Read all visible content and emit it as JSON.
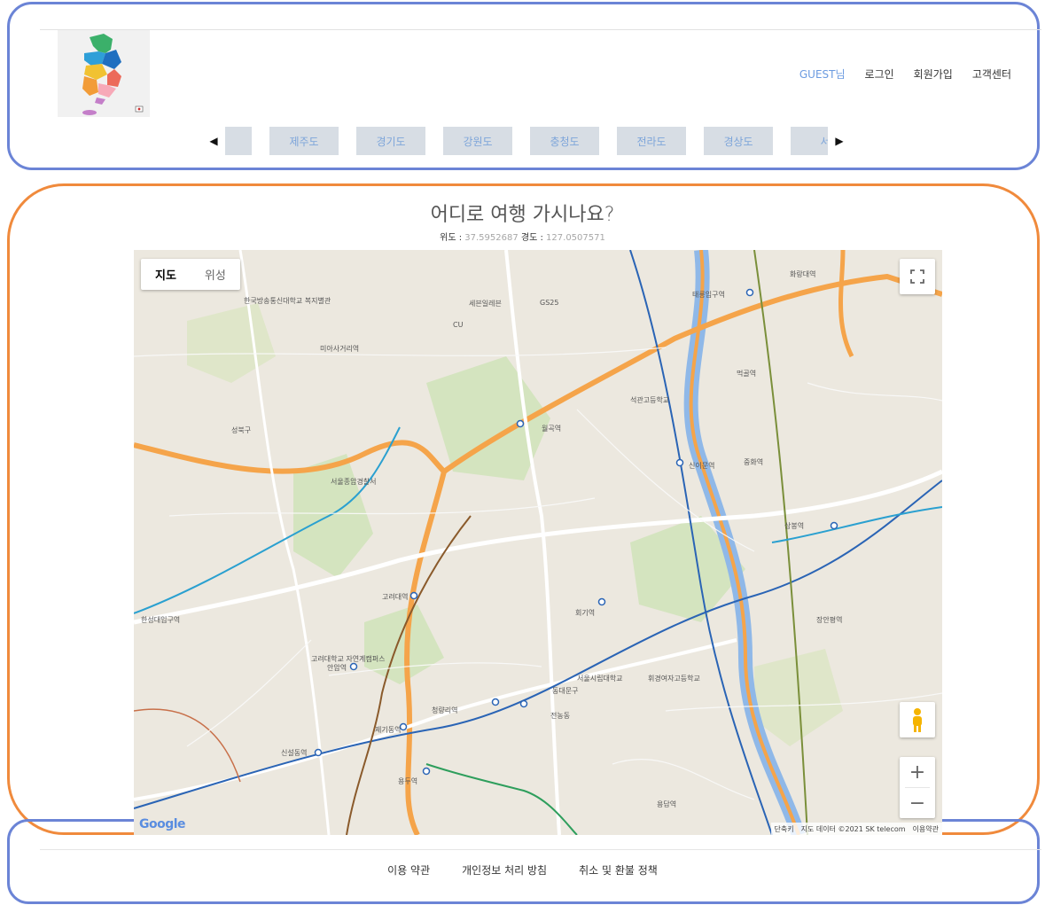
{
  "header": {
    "user": {
      "guest_label": "GUEST님",
      "login": "로그인",
      "signup": "회원가입",
      "support": "고객센터"
    },
    "regions": {
      "prev_arrow": "◀",
      "next_arrow": "▶",
      "items": [
        "제주도",
        "경기도",
        "강원도",
        "충청도",
        "전라도",
        "경상도",
        "서"
      ]
    }
  },
  "main": {
    "title": "어디로 여행 가시나요?",
    "latitude_label": "위도 :",
    "latitude_value": "37.5952687",
    "longitude_label": "경도 :",
    "longitude_value": "127.0507571",
    "map": {
      "type_map": "지도",
      "type_satellite": "위성",
      "zoom_in": "+",
      "zoom_out": "−",
      "google": "Google",
      "attribution": [
        "단축키",
        "지도 데이터 ©2021 SK telecom",
        "이용약관"
      ],
      "labels": [
        "한국방송통신대학교 복지별관",
        "세븐일레븐",
        "GS25",
        "CU",
        "태릉입구역",
        "화랑대역",
        "미아사거리역",
        "성북구",
        "월곡역",
        "석관고등학교",
        "신이문역",
        "서울종암경찰서",
        "고려대역",
        "회기역",
        "한성대입구역",
        "안암역",
        "청량리역",
        "제기동역",
        "신설동역",
        "용두역",
        "상봉역",
        "중화역",
        "먹골역",
        "장안평역",
        "고려대학교 자연계캠퍼스",
        "서울시립대학교",
        "휘경여자고등학교",
        "동대문구",
        "전농동",
        "용답역"
      ]
    }
  },
  "footer": {
    "links": [
      "이용 약관",
      "개인정보 처리 방침",
      "취소 및 환불 정책"
    ]
  },
  "colors": {
    "header_frame": "#6b84d6",
    "main_frame": "#f08a3c",
    "tab_bg": "#d7dde4",
    "tab_text": "#7da5da",
    "guest_text": "#6b9be0"
  }
}
